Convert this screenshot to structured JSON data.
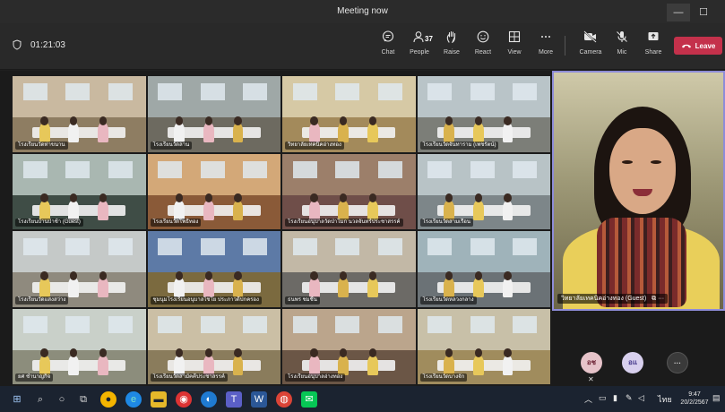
{
  "window": {
    "title": "Meeting now",
    "min": "—",
    "max": "☐",
    "close": "✕"
  },
  "toolbar": {
    "timer": "01:21:03",
    "chat": "Chat",
    "people": "People",
    "people_count": "37",
    "raise": "Raise",
    "react": "React",
    "view": "View",
    "more": "More",
    "camera": "Camera",
    "mic": "Mic",
    "share": "Share",
    "leave": "Leave"
  },
  "tiles": [
    {
      "name": "โรงเรียนวัดท่าขนาน",
      "wall": "#c9b9a0",
      "floor": "#8e7d62"
    },
    {
      "name": "โรงเรียนวัดลาน",
      "wall": "#9fa8a7",
      "floor": "#6d6a60"
    },
    {
      "name": "วิทยาลัยเทคนิคอ่างทอง",
      "wall": "#d6c9a5",
      "floor": "#a38a5b"
    },
    {
      "name": "โรงเรียนวัดจันทาราม (เพชรัตน์)",
      "wall": "#b9c4c8",
      "floor": "#7c7e78"
    },
    {
      "name": "โรงเรียนบ้านป่าช้า (Guest)",
      "wall": "#a9b7b1",
      "floor": "#3f4d46"
    },
    {
      "name": "โรงเรียนวัดโพธิ์ทอง",
      "wall": "#d3a878",
      "floor": "#8a5a38"
    },
    {
      "name": "โรงเรียนอนุบาลวัดป่าโมก นวลจันทร์ประชาสรรค์",
      "wall": "#9c7f6a",
      "floor": "#6f4e49"
    },
    {
      "name": "โรงเรียนวัดสามเรือน",
      "wall": "#b8c3c6",
      "floor": "#7d8689"
    },
    {
      "name": "โรงเรียนวัดแสงสว่าง",
      "wall": "#c5c9c8",
      "floor": "#8f8a7e"
    },
    {
      "name": "ชุมนุมโรงเรียนอนุบาลไชโย ประภาวดีปกครอง",
      "wall": "#5d7aa6",
      "floor": "#7b6a3f"
    },
    {
      "name": "ธนพร ชมชื่น",
      "wall": "#c2b8a6",
      "floor": "#6c6a66"
    },
    {
      "name": "โรงเรียนวัดหลวงกลาง",
      "wall": "#9fb3ba",
      "floor": "#6b7276"
    },
    {
      "name": "ยศ ชำนาญกิจ",
      "wall": "#c9d0c9",
      "floor": "#8c8d7c"
    },
    {
      "name": "โรงเรียนวัดสามัคคีประชาสรรค์",
      "wall": "#cbbfa5",
      "floor": "#8a7c5c"
    },
    {
      "name": "โรงเรียนอนุบาลอ่างทอง",
      "wall": "#bba58c",
      "floor": "#6b5646"
    },
    {
      "name": "โรงเรียนวัดบางจัก",
      "wall": "#c8c0a8",
      "floor": "#a08c5d"
    }
  ],
  "spotlight": {
    "name": "วิทยาลัยเทคนิคอ่างทอง (Guest)"
  },
  "overflow": {
    "avatar1": "อช",
    "avatar2": "อแ",
    "more": "···"
  },
  "taskbar": {
    "lang": "ไทย",
    "time": "9:47",
    "date": "20/2/2567"
  }
}
